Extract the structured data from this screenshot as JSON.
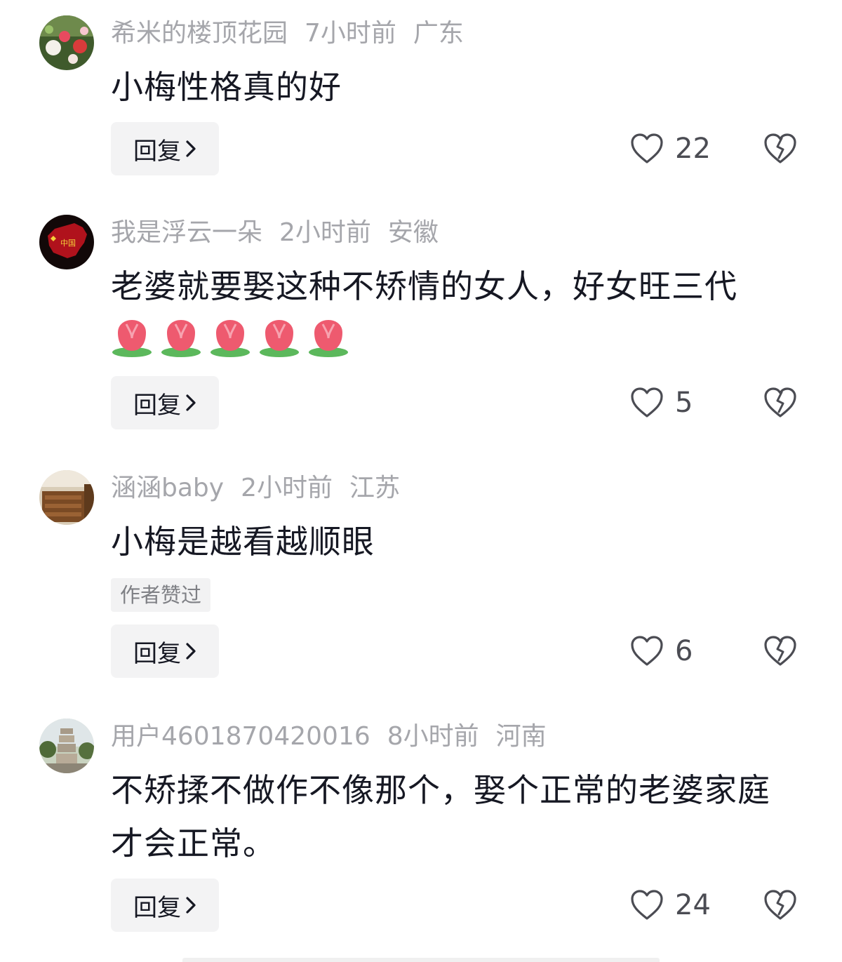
{
  "comments": [
    {
      "username": "希米的楼顶花园",
      "time": "7小时前",
      "location": "广东",
      "text": "小梅性格真的好",
      "reply_label": "回复",
      "likes": "22",
      "avatar_icon": "flower-garden-avatar"
    },
    {
      "username": "我是浮云一朵",
      "time": "2小时前",
      "location": "安徽",
      "text": "老婆就要娶这种不矫情的女人，好女旺三代",
      "emoji": [
        "tulip",
        "tulip",
        "tulip",
        "tulip",
        "tulip"
      ],
      "reply_label": "回复",
      "likes": "5",
      "avatar_icon": "china-map-avatar",
      "avatar_text": "中国"
    },
    {
      "username": "涵涵baby",
      "time": "2小时前",
      "location": "江苏",
      "text": "小梅是越看越顺眼",
      "badge": "作者赞过",
      "reply_label": "回复",
      "likes": "6",
      "avatar_icon": "wooden-interior-avatar"
    },
    {
      "username": "用户4601870420016",
      "time": "8小时前",
      "location": "河南",
      "text": "不矫揉不做作不像那个，娶个正常的老婆家庭才会正常。",
      "reply_label": "回复",
      "likes": "24",
      "avatar_icon": "pagoda-avatar"
    }
  ],
  "icons": {
    "like": "heart-icon",
    "dislike": "broken-heart-icon",
    "reply_arrow": "chevron-right-icon"
  },
  "colors": {
    "meta_text": "#a5a6ab",
    "body_text": "#161823",
    "button_bg": "#f3f3f4",
    "like_count": "#4b4c53"
  }
}
